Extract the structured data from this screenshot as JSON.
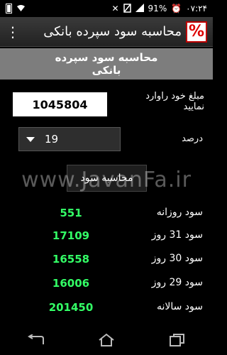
{
  "status_bar": {
    "time": "۰۷:۲۴",
    "battery": "91%",
    "icons": [
      "clock-icon",
      "signal-icon",
      "no-sim-icon",
      "bluetooth-off-icon",
      "wifi-icon",
      "battery-icon"
    ]
  },
  "action_bar": {
    "title": "محاسبه سود سپرده بانکی",
    "app_icon_text": "%",
    "menu_icon": "overflow-menu-icon"
  },
  "section": {
    "header_line1": "محاسبه سود سپرده",
    "header_line2": "بانکی"
  },
  "form": {
    "amount_label_line1": "مبلغ خود راوارد",
    "amount_label_line2": "نمایید",
    "amount_value": "1045804",
    "percent_label": "درصد",
    "percent_value": "19",
    "calc_button": "محاسبه سود"
  },
  "watermark": "www.JavanFa.ir",
  "results": [
    {
      "label": "سود روزانه",
      "value": "551"
    },
    {
      "label": "سود 31 روز",
      "value": "17109"
    },
    {
      "label": "سود 30 روز",
      "value": "16558"
    },
    {
      "label": "سود 29 روز",
      "value": "16006"
    },
    {
      "label": "سود سالانه",
      "value": "201450"
    }
  ],
  "colors": {
    "result_green": "#33ff66",
    "header_gray": "#7d7d7d"
  }
}
